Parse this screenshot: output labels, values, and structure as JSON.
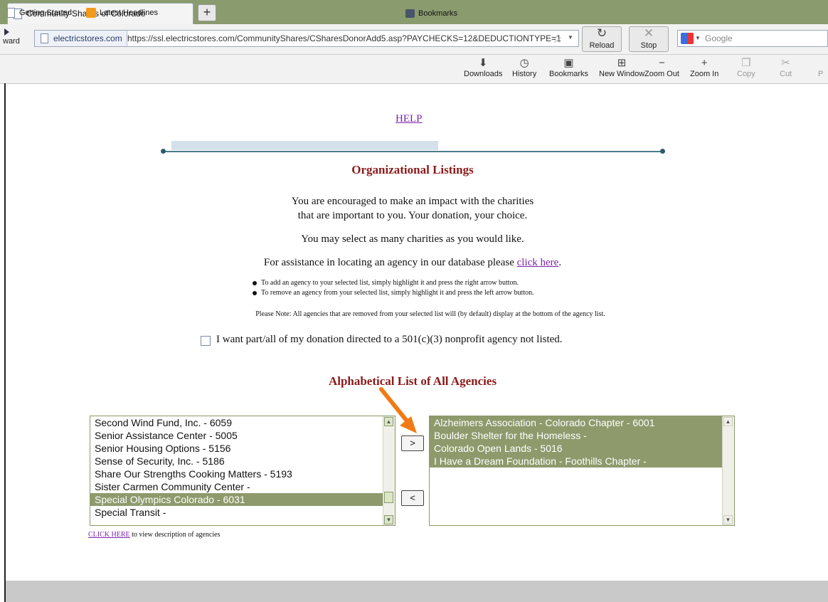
{
  "browser": {
    "tab_title": "Community Shares of Colorado",
    "new_tab_label": "+",
    "forward_label": "ward",
    "site_label": "electricstores.com",
    "url": "https://ssl.electricstores.com/CommunityShares/CSharesDonorAdd5.asp?PAYCHECKS=12&DEDUCTIONTYPE=1",
    "reload_label": "Reload",
    "stop_label": "Stop",
    "search_placeholder": "Google",
    "bookmarks": [
      {
        "label": "Getting Started"
      },
      {
        "label": "Latest Headlines"
      }
    ],
    "bookmarks_menu_label": "Bookmarks",
    "toolbar": [
      {
        "label": "Downloads",
        "icon": "download-icon"
      },
      {
        "label": "History",
        "icon": "history-icon"
      },
      {
        "label": "Bookmarks",
        "icon": "bookmarks-icon"
      },
      {
        "label": "New Window",
        "icon": "new-window-icon"
      },
      {
        "label": "Zoom Out",
        "icon": "zoom-out-icon"
      },
      {
        "label": "Zoom In",
        "icon": "zoom-in-icon"
      },
      {
        "label": "Copy",
        "icon": "copy-icon"
      },
      {
        "label": "Cut",
        "icon": "cut-icon"
      },
      {
        "label": "P",
        "icon": "paste-icon"
      }
    ]
  },
  "page": {
    "help_link": "HELP",
    "title": "Organizational Listings",
    "intro_line1": "You are encouraged to make an impact with the charities",
    "intro_line2": "that are important to you. Your donation, your choice.",
    "intro_line3": "You may select as many charities as you would like.",
    "assist_text": "For assistance in locating an agency in our database please ",
    "assist_link": "click here",
    "assist_period": ".",
    "bullets": [
      "To add an agency to your selected list, simply highlight it and press the right arrow button.",
      "To remove an agency from your selected list, simply highlight it and press the left arrow button."
    ],
    "note": "Please Note: All agencies that are removed from your selected list will (by default) display at the bottom of the agency list.",
    "checkbox_label": "I want part/all of my donation directed to a 501(c)(3) nonprofit agency not listed.",
    "list_title": "Alphabetical List of All Agencies",
    "all_agencies": [
      "Second Wind Fund, Inc. - 6059",
      "Senior Assistance Center - 5005",
      "Senior Housing Options - 5156",
      "Sense of Security, Inc. - 5186",
      "Share Our Strengths Cooking Matters - 5193",
      "Sister Carmen Community Center -",
      "Special Olympics Colorado - 6031",
      "Special Transit -"
    ],
    "all_selected_index": 6,
    "selected_agencies": [
      "Alzheimers Association - Colorado Chapter - 6001",
      "Boulder Shelter for the Homeless -",
      "Colorado Open Lands - 5016",
      "I Have a Dream Foundation - Foothills Chapter -"
    ],
    "add_button": ">",
    "remove_button": "<",
    "view_link": "CLICK HERE",
    "view_text": " to view description of agencies"
  },
  "colors": {
    "heading": "#8b1a1a",
    "link": "#7a24a8",
    "selection": "#8e9a6c",
    "callout_arrow": "#f07b16"
  }
}
